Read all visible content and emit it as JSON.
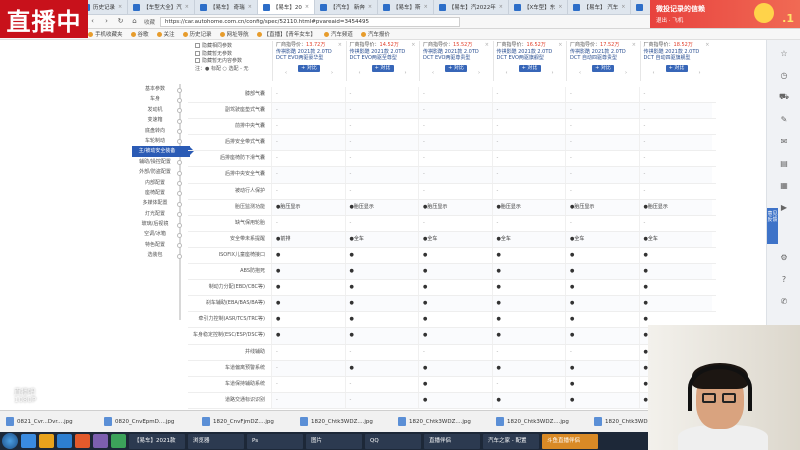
{
  "overlay": {
    "live_badge": "直播中",
    "promo_title": "微投记录的信赖",
    "promo_sub": "退出 · 飞机",
    "promo_number": ".1"
  },
  "browser": {
    "tabs": [
      {
        "label": "历史记录",
        "active": false
      },
      {
        "label": "【车型大全】汽",
        "active": false
      },
      {
        "label": "【易车】 奇瑞",
        "active": false
      },
      {
        "label": "【易车】20",
        "active": true
      },
      {
        "label": "【汽车】 新奔",
        "active": false
      },
      {
        "label": "【易车】斯",
        "active": false
      },
      {
        "label": "【易车】汽2022年",
        "active": false
      },
      {
        "label": "【X车型】东",
        "active": false
      },
      {
        "label": "【易车】 汽车",
        "active": false
      },
      {
        "label": "【易车】 广汽",
        "active": false
      },
      {
        "label": "【话题】进",
        "active": false
      },
      {
        "label": "汽车之家",
        "active": false
      }
    ],
    "nav_back": "‹",
    "nav_forward": "›",
    "nav_refresh": "↻",
    "nav_home": "⌂",
    "star_label": "收藏",
    "url": "https://car.autohome.com.cn/config/spec/52110.html#pvareaid=3454495",
    "bookmarks": [
      "手机收藏夹",
      "谷歌",
      "关注",
      "历史记录",
      "网址导航",
      "【直播】【青年女车】",
      "汽车频道",
      "汽车报价"
    ]
  },
  "options": [
    "隐藏相同参数",
    "隐藏暂无参数",
    "隐藏暂无内容参数",
    "注：● 标配  ○ 选配  - 无"
  ],
  "models": [
    {
      "price_label": "厂商指导价：",
      "price": "13.72万",
      "name": "传祺影酷 2021款 2.0TD DCT EVO两驱豪华型",
      "compare": "+ 对比"
    },
    {
      "price_label": "厂商指导价：",
      "price": "14.52万",
      "name": "传祺影酷 2021款 2.0TD DCT EVO两驱至尊型",
      "compare": "+ 对比"
    },
    {
      "price_label": "厂商指导价：",
      "price": "15.52万",
      "name": "传祺影酷 2021款 2.0TD DCT EVO两驱尊贵型",
      "compare": "+ 对比"
    },
    {
      "price_label": "厂商指导价：",
      "price": "16.52万",
      "name": "传祺影酷 2021款 2.0TD DCT EVO两驱旗舰型",
      "compare": "+ 对比"
    },
    {
      "price_label": "厂商指导价：",
      "price": "17.52万",
      "name": "传祺影酷 2021款 2.0TD DCT 自动四驱尊贵型",
      "compare": "+ 对比"
    },
    {
      "price_label": "厂商指导价：",
      "price": "18.52万",
      "name": "传祺影酷 2021款 2.0TD DCT 自动四驱旗舰型",
      "compare": "+ 对比"
    }
  ],
  "leftnav": [
    {
      "label": "基本参数",
      "active": false
    },
    {
      "label": "车身",
      "active": false
    },
    {
      "label": "发动机",
      "active": false
    },
    {
      "label": "变速箱",
      "active": false
    },
    {
      "label": "底盘转向",
      "active": false
    },
    {
      "label": "车轮制动",
      "active": false
    },
    {
      "label": "主/被动安全装备",
      "active": true
    },
    {
      "label": "辅助/操控配置",
      "active": false
    },
    {
      "label": "外部/防盗配置",
      "active": false
    },
    {
      "label": "内部配置",
      "active": false
    },
    {
      "label": "座椅配置",
      "active": false
    },
    {
      "label": "多媒体配置",
      "active": false
    },
    {
      "label": "灯光配置",
      "active": false
    },
    {
      "label": "玻璃/后视镜",
      "active": false
    },
    {
      "label": "空调/冰箱",
      "active": false
    },
    {
      "label": "特色配置",
      "active": false
    },
    {
      "label": "选装包",
      "active": false
    }
  ],
  "rows": [
    {
      "label": "膝部气囊",
      "cells": [
        "-",
        "-",
        "-",
        "-",
        "-",
        "-"
      ]
    },
    {
      "label": "副驾驶座垫式气囊",
      "cells": [
        "-",
        "-",
        "-",
        "-",
        "-",
        "-"
      ]
    },
    {
      "label": "前排中央气囊",
      "cells": [
        "-",
        "-",
        "-",
        "-",
        "-",
        "-"
      ]
    },
    {
      "label": "后排安全带式气囊",
      "cells": [
        "-",
        "-",
        "-",
        "-",
        "-",
        "-"
      ]
    },
    {
      "label": "后排座椅防下滑气囊",
      "cells": [
        "-",
        "-",
        "-",
        "-",
        "-",
        "-"
      ]
    },
    {
      "label": "后排中央安全气囊",
      "cells": [
        "-",
        "-",
        "-",
        "-",
        "-",
        "-"
      ]
    },
    {
      "label": "被动行人保护",
      "cells": [
        "-",
        "-",
        "-",
        "-",
        "-",
        "-"
      ]
    },
    {
      "label": "胎压监测功能",
      "cells": [
        "●胎压显示",
        "●胎压显示",
        "●胎压显示",
        "●胎压显示",
        "●胎压显示",
        "●胎压显示"
      ]
    },
    {
      "label": "缺气保用轮胎",
      "cells": [
        "-",
        "-",
        "-",
        "-",
        "-",
        "-"
      ]
    },
    {
      "label": "安全带未系提醒",
      "cells": [
        "●前排",
        "●全车",
        "●全车",
        "●全车",
        "●全车",
        "●全车"
      ]
    },
    {
      "label": "ISOFIX儿童座椅接口",
      "cells": [
        "●",
        "●",
        "●",
        "●",
        "●",
        "●"
      ]
    },
    {
      "label": "ABS防抱死",
      "cells": [
        "●",
        "●",
        "●",
        "●",
        "●",
        "●"
      ]
    },
    {
      "label": "制动力分配(EBD/CBC等)",
      "cells": [
        "●",
        "●",
        "●",
        "●",
        "●",
        "●"
      ]
    },
    {
      "label": "刹车辅助(EBA/BAS/BA等)",
      "cells": [
        "●",
        "●",
        "●",
        "●",
        "●",
        "●"
      ]
    },
    {
      "label": "牵引力控制(ASR/TCS/TRC等)",
      "cells": [
        "●",
        "●",
        "●",
        "●",
        "●",
        "●"
      ]
    },
    {
      "label": "车身稳定控制(ESC/ESP/DSC等)",
      "cells": [
        "●",
        "●",
        "●",
        "●",
        "●",
        "●"
      ]
    },
    {
      "label": "并线辅助",
      "cells": [
        "-",
        "-",
        "-",
        "-",
        "-",
        "●"
      ]
    },
    {
      "label": "车道偏离预警系统",
      "cells": [
        "-",
        "●",
        "●",
        "●",
        "●",
        "●"
      ]
    },
    {
      "label": "车道保持辅助系统",
      "cells": [
        "-",
        "-",
        "●",
        "-",
        "●",
        "●"
      ]
    },
    {
      "label": "道路交通标识识别",
      "cells": [
        "-",
        "-",
        "●",
        "●",
        "●",
        "●"
      ]
    }
  ],
  "rsidebar": {
    "icons": [
      "star-icon",
      "clock-icon",
      "car-icon",
      "note-icon",
      "mail-icon",
      "doc-icon",
      "grid-icon",
      "video-icon",
      "settings-icon",
      "help-icon",
      "chat-icon"
    ],
    "feedback": "意见反馈"
  },
  "downloads": [
    "0821_Cvr...Dvr....jpg",
    "0820_CnvEpmD....jpg",
    "1820_CnvFjmDZ....jpg",
    "1820_Chtk3WDZ....jpg",
    "1820_Chtk3WDZ....jpg",
    "1820_Chtk3WDZ....jpg",
    "1820_Chtk3WDZ....jpg"
  ],
  "taskbar": {
    "tasks": [
      {
        "label": "【易车】2021款",
        "highlight": false
      },
      {
        "label": "浏览器",
        "highlight": false
      },
      {
        "label": "Ps",
        "highlight": false
      },
      {
        "label": "图片",
        "highlight": false
      },
      {
        "label": "QQ",
        "highlight": false
      },
      {
        "label": "直播伴侣",
        "highlight": false
      },
      {
        "label": "汽车之家 - 配置",
        "highlight": false
      },
      {
        "label": "斗鱼直播伴侣",
        "highlight": true
      }
    ]
  },
  "watermark": "直播吧\n1080P"
}
